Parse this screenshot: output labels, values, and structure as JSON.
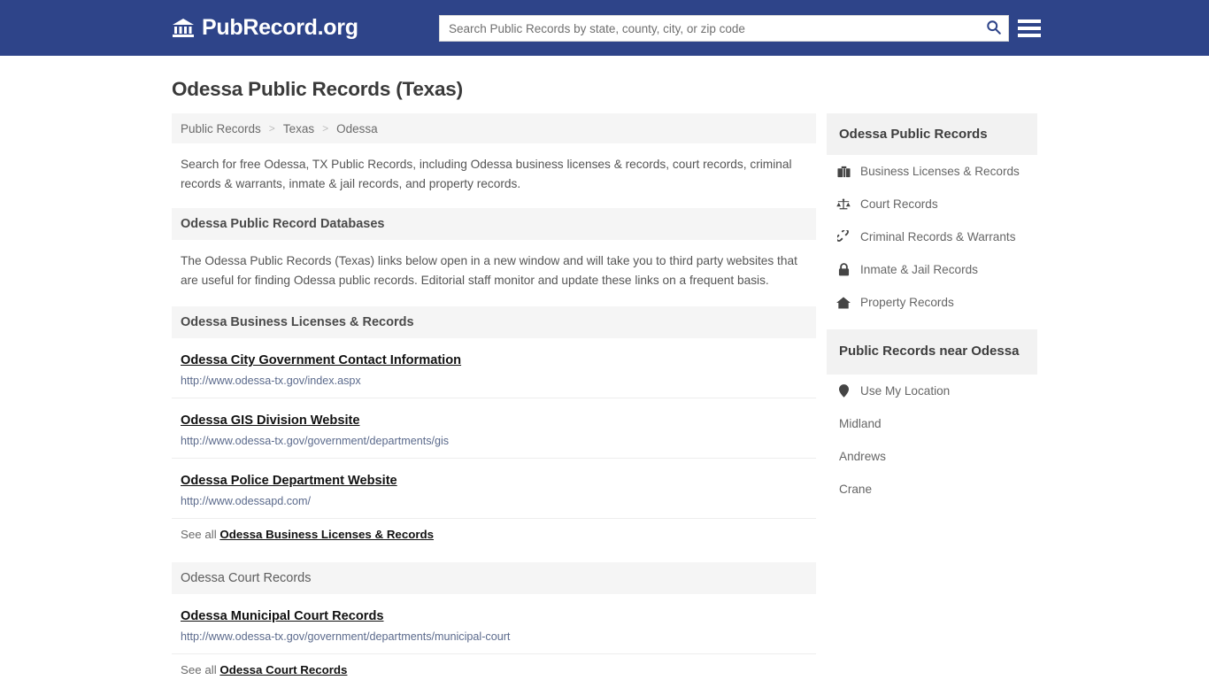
{
  "header": {
    "brand_name": "PubRecord.org",
    "brand_icon": "bank-building-icon",
    "search_placeholder": "Search Public Records by state, county, city, or zip code",
    "search_value": "",
    "search_icon": "search-icon",
    "menu_icon": "hamburger-menu-icon"
  },
  "main": {
    "page_title": "Odessa Public Records (Texas)",
    "breadcrumb": [
      {
        "label": "Public Records"
      },
      {
        "label": "Texas"
      },
      {
        "label": "Odessa"
      }
    ],
    "breadcrumb_separator": ">",
    "intro": "Search for free Odessa, TX Public Records, including Odessa business licenses & records, court records, criminal records & warrants, inmate & jail records, and property records.",
    "databases_heading": "Odessa Public Record Databases",
    "databases_blurb": "The Odessa Public Records (Texas) links below open in a new window and will take you to third party websites that are useful for finding Odessa public records. Editorial staff monitor and update these links on a frequent basis.",
    "sections": [
      {
        "heading": "Odessa Business Licenses & Records",
        "heading_style": "bold",
        "entries": [
          {
            "title": "Odessa City Government Contact Information",
            "url": "http://www.odessa-tx.gov/index.aspx"
          },
          {
            "title": "Odessa GIS Division Website",
            "url": "http://www.odessa-tx.gov/government/departments/gis"
          },
          {
            "title": "Odessa Police Department Website",
            "url": "http://www.odessapd.com/"
          }
        ],
        "see_all_prefix": "See all ",
        "see_all_link": "Odessa Business Licenses & Records"
      },
      {
        "heading": "Odessa Court Records",
        "heading_style": "light",
        "entries": [
          {
            "title": "Odessa Municipal Court Records",
            "url": "http://www.odessa-tx.gov/government/departments/municipal-court"
          }
        ],
        "see_all_prefix": "See all ",
        "see_all_link": "Odessa Court Records"
      }
    ]
  },
  "sidebar": {
    "records_heading": "Odessa Public Records",
    "records_items": [
      {
        "label": "Business Licenses & Records",
        "icon": "briefcase-icon"
      },
      {
        "label": "Court Records",
        "icon": "balance-scale-icon"
      },
      {
        "label": "Criminal Records & Warrants",
        "icon": "handcuffs-icon"
      },
      {
        "label": "Inmate & Jail Records",
        "icon": "lock-icon"
      },
      {
        "label": "Property Records",
        "icon": "home-icon"
      }
    ],
    "nearby_heading": "Public Records near Odessa",
    "nearby_items": [
      {
        "label": "Use My Location",
        "icon": "map-pin-icon"
      },
      {
        "label": "Midland",
        "icon": ""
      },
      {
        "label": "Andrews",
        "icon": ""
      },
      {
        "label": "Crane",
        "icon": ""
      }
    ]
  },
  "colors": {
    "header_blue": "#2e4489",
    "section_gray": "#f5f5f5",
    "url_blue": "#5b6a8c"
  }
}
